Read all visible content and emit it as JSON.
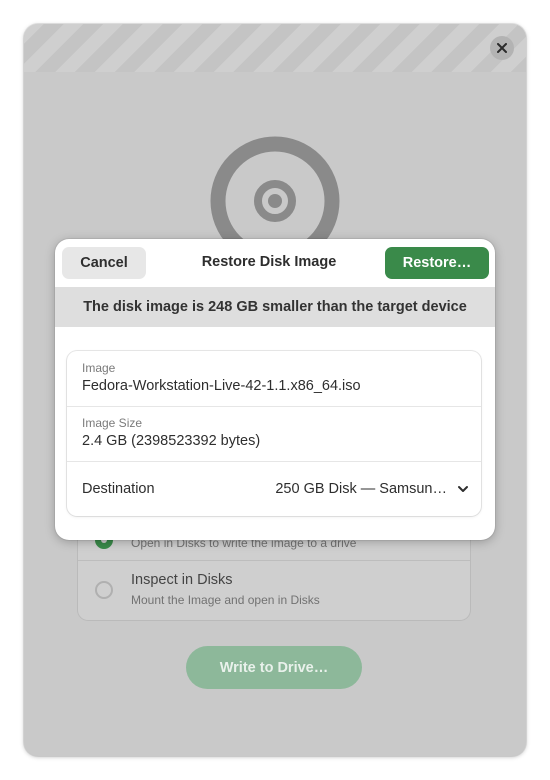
{
  "background": {
    "options": [
      {
        "title": "",
        "subtitle": "Open in Disks to write the image to a drive",
        "selected": true
      },
      {
        "title": "Inspect in Disks",
        "subtitle": "Mount the Image and open in Disks",
        "selected": false
      }
    ],
    "write_button_label": "Write to Drive…"
  },
  "dialog": {
    "cancel_label": "Cancel",
    "title": "Restore Disk Image",
    "restore_label": "Restore…",
    "banner": "The disk image is 248 GB smaller than the target device",
    "image_label": "Image",
    "image_value": "Fedora-Workstation-Live-42-1.1.x86_64.iso",
    "size_label": "Image Size",
    "size_value": "2.4 GB (2398523392 bytes)",
    "destination_label": "Destination",
    "destination_value": "250 GB Disk — Samsun…"
  },
  "colors": {
    "accent": "#3a8a4a",
    "backdrop": "#c9c9c9"
  }
}
